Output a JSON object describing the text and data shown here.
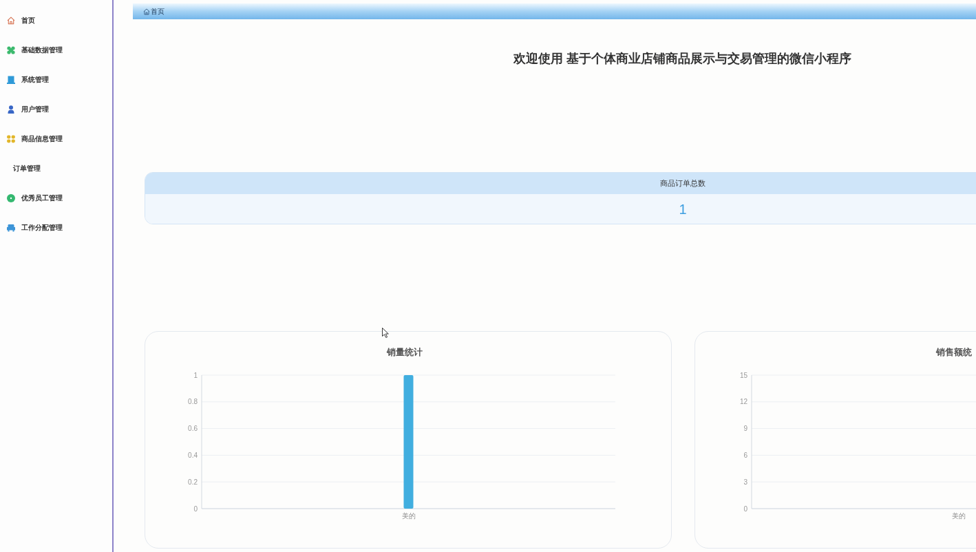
{
  "sidebar": {
    "items": [
      {
        "label": "首页"
      },
      {
        "label": "基础数据管理"
      },
      {
        "label": "系统管理"
      },
      {
        "label": "用户管理"
      },
      {
        "label": "商品信息管理"
      },
      {
        "label": "订单管理"
      },
      {
        "label": "优秀员工管理"
      },
      {
        "label": "工作分配管理"
      }
    ]
  },
  "breadcrumb": {
    "items": [
      {
        "label": "首页"
      }
    ]
  },
  "welcome_title": "欢迎使用 基于个体商业店铺商品展示与交易管理的微信小程序",
  "stats": [
    {
      "label": "商品订单总数",
      "value": "1"
    }
  ],
  "charts": [
    {
      "chart_data": {
        "type": "bar",
        "title": "销量统计",
        "categories": [
          "美的"
        ],
        "values": [
          1
        ],
        "color": "#41aedf",
        "ylim": [
          0,
          1
        ],
        "yticks": [
          0,
          0.2,
          0.4,
          0.6,
          0.8,
          1
        ],
        "grid": true
      }
    },
    {
      "chart_data": {
        "type": "bar",
        "title": "销售额统",
        "categories": [
          "美的"
        ],
        "values": [
          null
        ],
        "ylim": [
          0,
          15
        ],
        "yticks": [
          0,
          3,
          6,
          9,
          12,
          15
        ],
        "grid": true
      }
    }
  ]
}
